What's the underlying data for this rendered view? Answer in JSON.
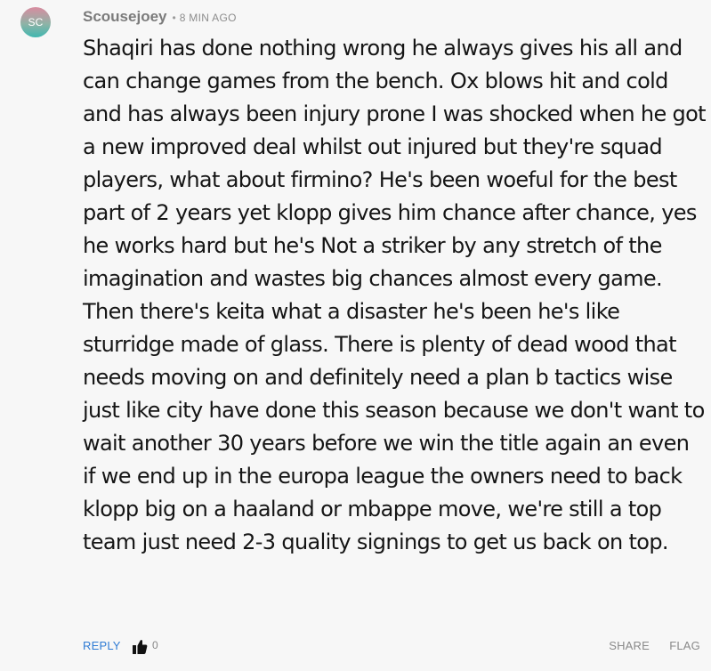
{
  "comment": {
    "avatar_initials": "SC",
    "username": "Scousejoey",
    "separator": "•",
    "time_ago": "8 MIN AGO",
    "body": "Shaqiri has done nothing wrong he always gives his all and can change games from the bench. Ox blows hit and cold and has always been injury prone I was shocked when he got a new improved deal whilst out injured but they're squad players, what about firmino? He's been woeful for the best part of 2 years yet klopp gives him chance after chance, yes he works hard but he's Not a striker by any stretch of the imagination and wastes big chances almost every game. Then there's keita what a disaster he's been he's like sturridge made of glass. There is plenty of dead wood that needs moving on and definitely need a plan b tactics wise just like city have done this season because we don't want to wait another 30 years before we win the title again an even if we end up in the europa league the owners need to back klopp big on a haaland or mbappe move, we're still a top team just need 2-3 quality signings to get us back on top.",
    "actions": {
      "reply_label": "REPLY",
      "like_icon": "thumbs-up-icon",
      "like_count": "0",
      "share_label": "SHARE",
      "flag_label": "FLAG"
    }
  },
  "colors": {
    "background": "#f7f7f7",
    "link": "#2f7bd4",
    "muted": "#8a8a8a",
    "text": "#151515"
  }
}
